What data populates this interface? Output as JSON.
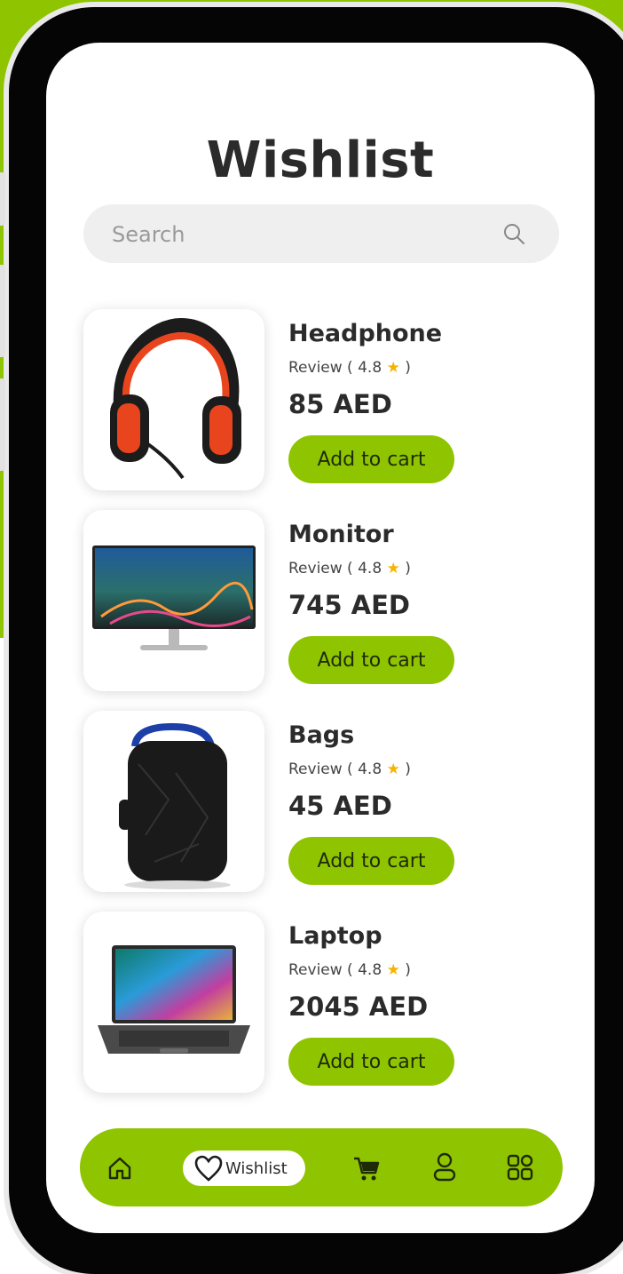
{
  "page": {
    "title": "Wishlist"
  },
  "search": {
    "placeholder": "Search"
  },
  "items": [
    {
      "name": "Headphone",
      "review_label": "Review (",
      "rating": "4.8",
      "price": "85 AED",
      "button": "Add to cart"
    },
    {
      "name": "Monitor",
      "review_label": "Review (",
      "rating": "4.8",
      "price": "745 AED",
      "button": "Add to cart"
    },
    {
      "name": "Bags",
      "review_label": "Review (",
      "rating": "4.8",
      "price": "45 AED",
      "button": "Add to cart"
    },
    {
      "name": "Laptop",
      "review_label": "Review (",
      "rating": "4.8",
      "price": "2045 AED",
      "button": "Add to cart"
    }
  ],
  "review_close": ")",
  "nav": {
    "items": [
      {
        "icon": "home-icon"
      },
      {
        "icon": "heart-icon",
        "label": "Wishlist",
        "active": true
      },
      {
        "icon": "cart-icon"
      },
      {
        "icon": "user-icon"
      },
      {
        "icon": "grid-icon"
      }
    ]
  },
  "colors": {
    "accent": "#8fc400",
    "star": "#f5b400",
    "text": "#2b2b2b"
  }
}
